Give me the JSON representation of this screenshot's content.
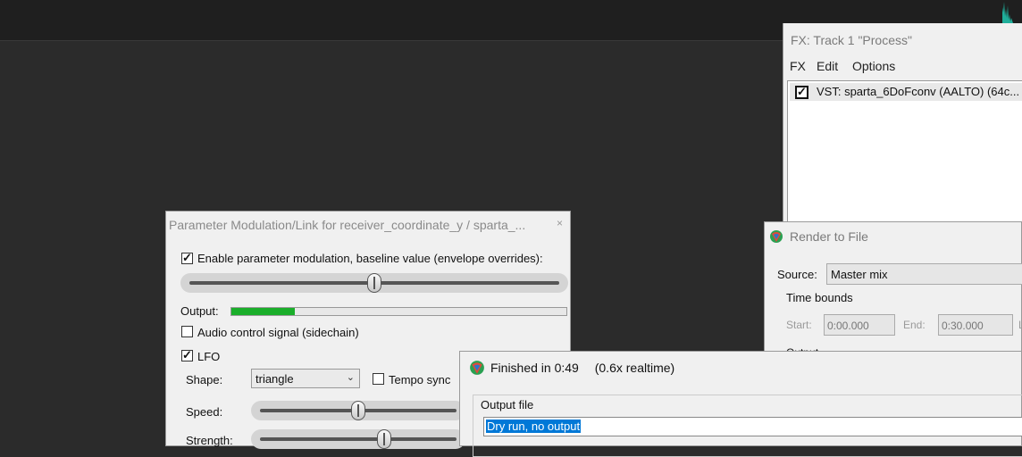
{
  "fx_window": {
    "title": "FX: Track 1 \"Process\"",
    "menu": [
      "FX",
      "Edit",
      "Options"
    ],
    "plugin": {
      "label": "VST: sparta_6DoFconv (AALTO) (64c...",
      "enabled": true
    }
  },
  "param_mod": {
    "title": "Parameter Modulation/Link for receiver_coordinate_y / sparta_...",
    "close_glyph": "×",
    "enable_label": "Enable parameter modulation, baseline value (envelope overrides):",
    "enable_checked": true,
    "baseline_value": 0.5,
    "output_label": "Output:",
    "output_level": 0.19,
    "audio_control_label": "Audio control signal (sidechain)",
    "audio_control_checked": false,
    "lfo_label": "LFO",
    "lfo_checked": true,
    "shape_label": "Shape:",
    "shape_value": "triangle",
    "tempo_sync_label": "Tempo sync",
    "tempo_sync_checked": false,
    "speed_label": "Speed:",
    "speed_value": 0.5,
    "strength_label": "Strength:",
    "strength_value": 0.63
  },
  "render_window": {
    "title": "Render to File",
    "source_label": "Source:",
    "source_value": "Master mix",
    "time_bounds_label": "Time bounds",
    "start_label": "Start:",
    "start_value": "0:00.000",
    "end_label": "End:",
    "end_value": "0:30.000",
    "length_label_fragment": "L",
    "output_label_fragment": "Output"
  },
  "finished_window": {
    "title": "Finished in 0:49",
    "realtime": "(0.6x realtime)",
    "output_file_label": "Output file",
    "output_file_value": "Dry run, no output"
  },
  "colors": {
    "accent_green": "#1aae2a",
    "selection_blue": "#0078d7"
  },
  "icons": [
    "checkbox-icon",
    "dropdown-arrow-icon",
    "close-icon",
    "reaper-logo-icon",
    "slider-thumb-icon"
  ]
}
